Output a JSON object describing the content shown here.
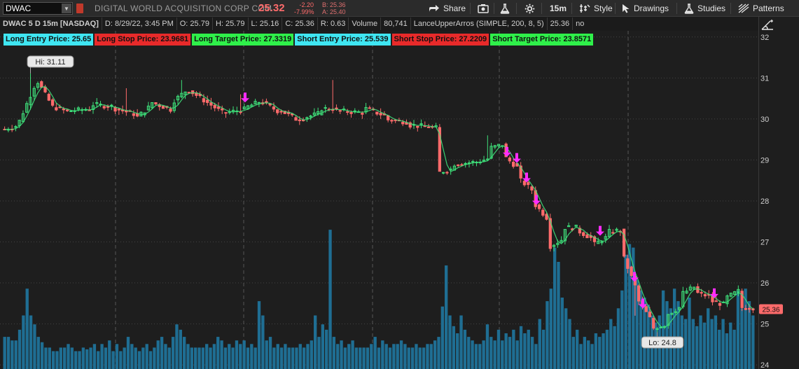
{
  "toolbar": {
    "symbol": "DWAC",
    "company_name": "DIGITAL WORLD ACQUISITION CORP COM",
    "last_price": "25.32",
    "net_change": "-2.20",
    "pct_change": "-7.99%",
    "bid": "B: 25.36",
    "ask": "A: 25.40",
    "share_label": "Share",
    "timeframe_label": "15m",
    "style_label": "Style",
    "drawings_label": "Drawings",
    "studies_label": "Studies",
    "patterns_label": "Patterns",
    "colors": {
      "down": "#ff6b6b",
      "accent_link": "#c0392b"
    }
  },
  "chart_header": {
    "title": "DWAC 5 D 15m [NASDAQ]",
    "date": "D: 8/29/22, 3:45 PM",
    "open": "O: 25.79",
    "high": "H: 25.79",
    "low": "L: 25.16",
    "close": "C: 25.36",
    "range": "R: 0.63",
    "volume_label": "Volume",
    "volume_value": "80,741",
    "study_name": "LanceUpperArros (SIMPLE, 200, 8, 5)",
    "study_value": "25.36",
    "study_flag": "no"
  },
  "labels": [
    {
      "text": "Long Entry Price: 25.65",
      "color": "cyan"
    },
    {
      "text": "Long Stop Price: 23.9681",
      "color": "red"
    },
    {
      "text": "Long Target Price: 27.3319",
      "color": "green"
    },
    {
      "text": "Short Entry Price: 25.539",
      "color": "cyan"
    },
    {
      "text": "Short Stop Price: 27.2209",
      "color": "red"
    },
    {
      "text": "Short Target Price: 23.8571",
      "color": "green"
    }
  ],
  "chart_data": {
    "type": "candlestick",
    "ylim": [
      23.9,
      32.15
    ],
    "price_ticks": [
      "32",
      "31",
      "30",
      "29",
      "28",
      "27",
      "26",
      "25",
      "24"
    ],
    "last_price_tag": "25.36",
    "hi_label": "Hi: 31.11",
    "lo_label": "Lo: 24.8",
    "hi_value": 31.11,
    "lo_value": 24.8,
    "colors": {
      "up": "#3ee07a",
      "down": "#ff6b6b",
      "volume": "#1f6e93",
      "arrow": "#ff2cff",
      "grid": "#444444"
    },
    "segments": [
      [
        0,
        29.75,
        29.85
      ],
      [
        4,
        29.95,
        31.0
      ],
      [
        9,
        30.9,
        30.3
      ],
      [
        13,
        30.3,
        30.15
      ],
      [
        18,
        30.2,
        30.25
      ],
      [
        24,
        30.35,
        30.3
      ],
      [
        30,
        30.25,
        30.1
      ],
      [
        36,
        30.05,
        30.35
      ],
      [
        40,
        30.4,
        30.2
      ],
      [
        46,
        30.45,
        30.75
      ],
      [
        50,
        30.7,
        30.4
      ],
      [
        55,
        30.4,
        30.1
      ],
      [
        60,
        30.15,
        30.25
      ],
      [
        66,
        30.3,
        30.45
      ],
      [
        70,
        30.4,
        30.15
      ],
      [
        75,
        30.2,
        29.95
      ],
      [
        80,
        30.0,
        30.15
      ],
      [
        86,
        30.25,
        30.25
      ],
      [
        90,
        30.2,
        30.15
      ],
      [
        98,
        30.25,
        30.05
      ],
      [
        104,
        29.98,
        29.92
      ],
      [
        110,
        29.85,
        29.8
      ],
      [
        116,
        29.78,
        29.78
      ],
      [
        118,
        28.7,
        28.8
      ],
      [
        122,
        28.9,
        28.95
      ],
      [
        128,
        28.95,
        29.05
      ],
      [
        132,
        29.3,
        29.4
      ],
      [
        136,
        29.05,
        28.75
      ],
      [
        140,
        28.5,
        28.2
      ],
      [
        144,
        27.9,
        27.5
      ],
      [
        148,
        26.9,
        27.1
      ],
      [
        152,
        27.35,
        27.35
      ],
      [
        156,
        27.25,
        27.05
      ],
      [
        160,
        26.95,
        27.15
      ],
      [
        164,
        27.25,
        27.3
      ],
      [
        168,
        26.6,
        25.7
      ],
      [
        172,
        25.55,
        25.0
      ],
      [
        176,
        24.9,
        25.0
      ],
      [
        180,
        25.25,
        25.45
      ],
      [
        184,
        25.75,
        25.95
      ],
      [
        188,
        25.75,
        25.65
      ],
      [
        192,
        25.55,
        25.45
      ],
      [
        196,
        25.65,
        25.85
      ],
      [
        200,
        25.75,
        25.4
      ]
    ],
    "spikes": [
      [
        7,
        31.11
      ],
      [
        33,
        30.75
      ],
      [
        48,
        30.95
      ],
      [
        64,
        30.6
      ],
      [
        89,
        30.95
      ],
      [
        131,
        29.6
      ],
      [
        171,
        25.2
      ],
      [
        177,
        24.8
      ]
    ],
    "volume_ylim": [
      0,
      100
    ],
    "volume": [
      18,
      18,
      16,
      16,
      22,
      30,
      45,
      30,
      25,
      18,
      15,
      12,
      12,
      10,
      10,
      12,
      12,
      14,
      12,
      10,
      10,
      12,
      11,
      12,
      14,
      10,
      14,
      12,
      16,
      10,
      14,
      10,
      12,
      18,
      14,
      12,
      10,
      12,
      14,
      10,
      12,
      16,
      18,
      14,
      12,
      18,
      25,
      22,
      18,
      14,
      12,
      12,
      12,
      12,
      14,
      12,
      14,
      18,
      16,
      12,
      14,
      12,
      16,
      14,
      16,
      12,
      14,
      12,
      38,
      30,
      16,
      18,
      12,
      14,
      12,
      14,
      12,
      12,
      12,
      14,
      12,
      14,
      16,
      30,
      18,
      25,
      22,
      78,
      18,
      14,
      16,
      12,
      14,
      16,
      12,
      12,
      12,
      12,
      14,
      18,
      12,
      16,
      14,
      12,
      14,
      14,
      16,
      14,
      12,
      12,
      14,
      12,
      12,
      14,
      14,
      16,
      18,
      35,
      58,
      30,
      24,
      20,
      30,
      22,
      18,
      16,
      14,
      14,
      16,
      25,
      18,
      16,
      22,
      16,
      20,
      18,
      22,
      16,
      24,
      20,
      22,
      18,
      14,
      28,
      22,
      38,
      45,
      68,
      60,
      40,
      34,
      28,
      18,
      22,
      14,
      18,
      16,
      14,
      20,
      18,
      20,
      22,
      28,
      24,
      34,
      44,
      64,
      70,
      68,
      50,
      44,
      40,
      36,
      30,
      26,
      30,
      44,
      38,
      34,
      45,
      38,
      30,
      28,
      40,
      28,
      24,
      30,
      26,
      34,
      28,
      30,
      22,
      28,
      20,
      26,
      22,
      44,
      34,
      45,
      38,
      30
    ]
  }
}
